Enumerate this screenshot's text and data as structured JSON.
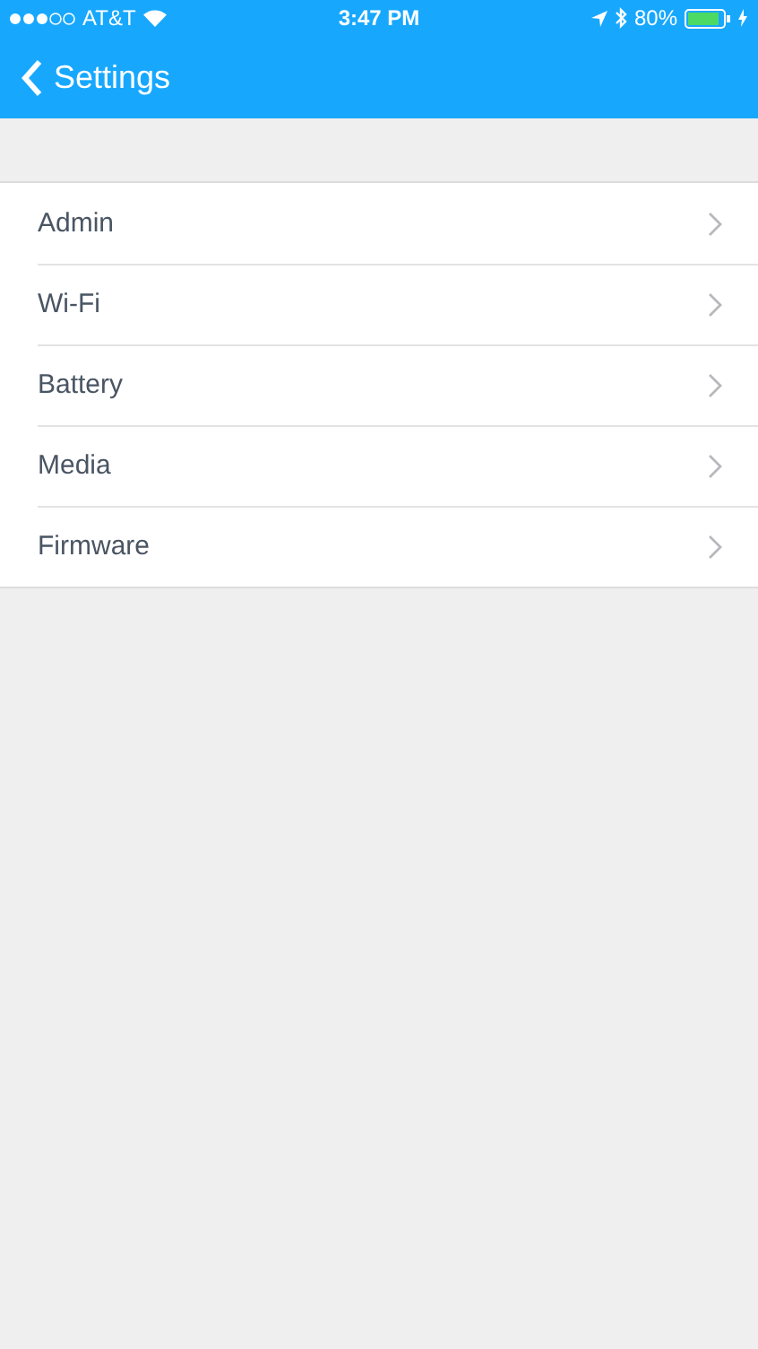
{
  "status_bar": {
    "carrier": "AT&T",
    "time": "3:47 PM",
    "battery": "80%"
  },
  "nav_bar": {
    "back_label": "Settings"
  },
  "settings": [
    {
      "label": "Admin"
    },
    {
      "label": "Wi-Fi"
    },
    {
      "label": "Battery"
    },
    {
      "label": "Media"
    },
    {
      "label": "Firmware"
    }
  ]
}
